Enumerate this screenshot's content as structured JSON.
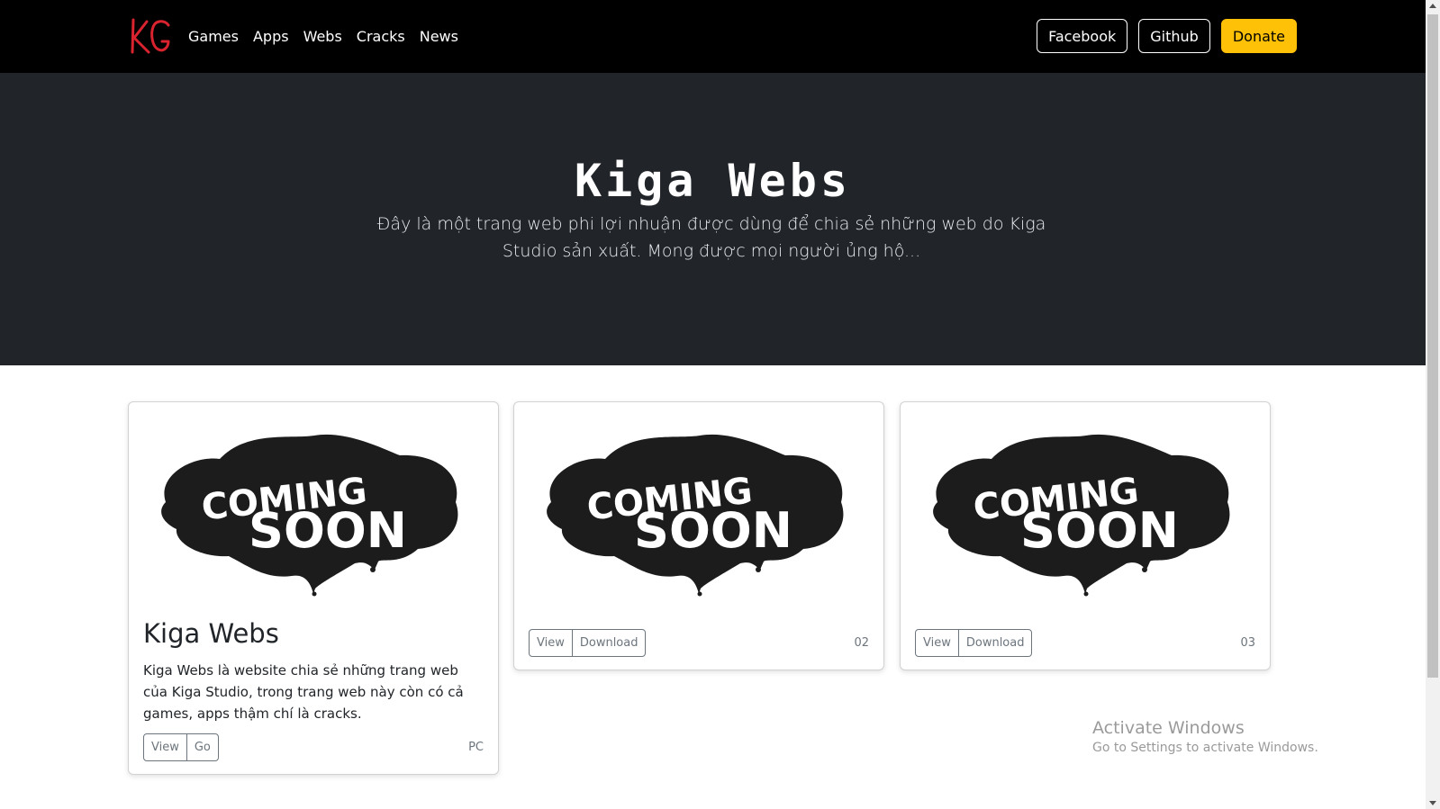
{
  "navbar": {
    "brand": "KG",
    "links": [
      "Games",
      "Apps",
      "Webs",
      "Cracks",
      "News"
    ],
    "buttons": {
      "facebook": "Facebook",
      "github": "Github",
      "donate": "Donate"
    }
  },
  "hero": {
    "title": "Kiga Webs",
    "description": "Đây là một trang web phi lợi nhuận được dùng để chia sẻ những web do Kiga Studio sản xuất. Mong được mọi người ủng hộ..."
  },
  "cards": [
    {
      "image_text": [
        "COMING",
        "SOON"
      ],
      "title": "Kiga Webs",
      "text": "Kiga Webs là website chia sẻ những trang web của Kiga Studio, trong trang web này còn có cả games, apps thậm chí là cracks.",
      "buttons": [
        "View",
        "Go"
      ],
      "meta": "PC"
    },
    {
      "image_text": [
        "COMING",
        "SOON"
      ],
      "buttons": [
        "View",
        "Download"
      ],
      "meta": "02"
    },
    {
      "image_text": [
        "COMING",
        "SOON"
      ],
      "buttons": [
        "View",
        "Download"
      ],
      "meta": "03"
    }
  ],
  "watermark": {
    "line1": "Activate Windows",
    "line2": "Go to Settings to activate Windows."
  },
  "colors": {
    "navbar_bg": "#000000",
    "hero_bg": "#212529",
    "donate": "#ffc107",
    "brand_red": "#d9232e"
  }
}
